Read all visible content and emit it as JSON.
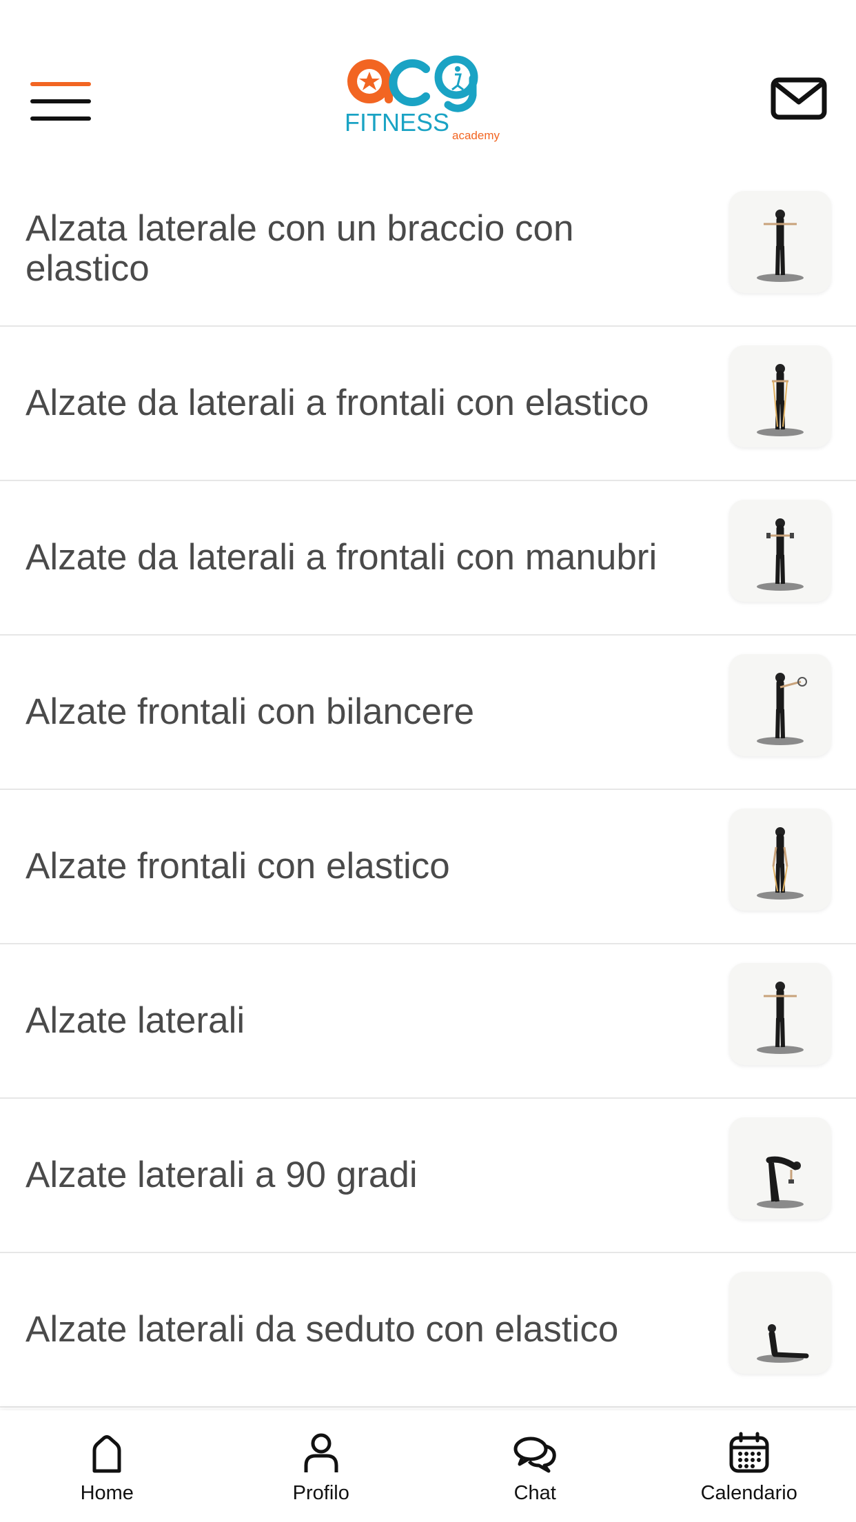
{
  "header": {
    "logo_text": "acg",
    "logo_sub": "FITNESS",
    "logo_small": "academy",
    "brand_orange": "#f26522",
    "brand_teal": "#1aa3c4"
  },
  "exercises": [
    {
      "label": "Alzata laterale con un braccio con elastico",
      "pose": "arms-side"
    },
    {
      "label": "Alzate da laterali a frontali con elastico",
      "pose": "band-front"
    },
    {
      "label": "Alzate da laterali a frontali con manubri",
      "pose": "db-front"
    },
    {
      "label": "Alzate frontali con bilancere",
      "pose": "barbell-front"
    },
    {
      "label": "Alzate frontali con elastico",
      "pose": "band-down"
    },
    {
      "label": "Alzate laterali",
      "pose": "arms-side"
    },
    {
      "label": "Alzate laterali a 90 gradi",
      "pose": "bent-over"
    },
    {
      "label": "Alzate laterali da seduto con elastico",
      "pose": "seated"
    }
  ],
  "tabbar": {
    "home": "Home",
    "profile": "Profilo",
    "chat": "Chat",
    "calendar": "Calendario"
  }
}
